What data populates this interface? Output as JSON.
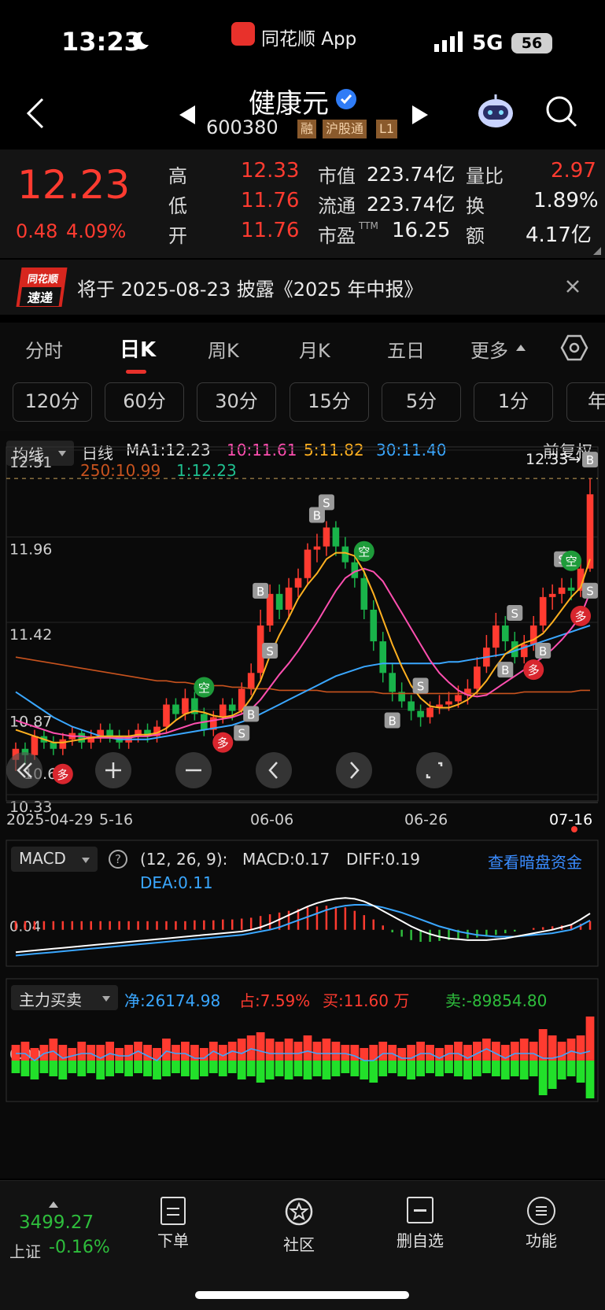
{
  "status_bar": {
    "time": "13:23",
    "app": "同花顺 App",
    "network": "5G",
    "battery": "56"
  },
  "header": {
    "name": "健康元",
    "code": "600380",
    "tags": [
      "融",
      "沪股通",
      "L1"
    ]
  },
  "quote": {
    "price": "12.23",
    "change": "0.48",
    "change_pct": "4.09%",
    "high_label": "高",
    "high": "12.33",
    "low_label": "低",
    "low": "11.76",
    "open_label": "开",
    "open": "11.76",
    "mktcap_label": "市值",
    "mktcap": "223.74亿",
    "float_label": "流通",
    "float": "223.74亿",
    "pe_label": "市盈",
    "pe_sup": "TTM",
    "pe": "16.25",
    "vr_label": "量比",
    "vr": "2.97",
    "turnover_label": "换",
    "turnover": "1.89%",
    "amount_label": "额",
    "amount": "4.17亿"
  },
  "notice": {
    "logo_top": "同花顺",
    "logo_bottom": "速递",
    "text": "将于 2025-08-23 披露《2025 年中报》"
  },
  "tabs": [
    "分时",
    "日K",
    "周K",
    "月K",
    "五日",
    "更多"
  ],
  "active_tab": "日K",
  "periods": [
    "120分",
    "60分",
    "30分",
    "15分",
    "5分",
    "1分",
    "年"
  ],
  "ma_legend": {
    "selector": "均线",
    "kind": "日线",
    "ma1": "MA1:12.23",
    "ma10": "10:11.61",
    "ma5": "5:11.82",
    "ma30": "30:11.40",
    "ma250": "250:10.99",
    "ma1b": "1:12.23",
    "adjust": "前复权"
  },
  "price_axis": [
    "12.51",
    "11.96",
    "11.42",
    "10.87",
    "10.33"
  ],
  "last_label": "10.60",
  "high_marker": "12.33→",
  "date_axis": [
    "2025-04-29",
    "5-16",
    "06-06",
    "06-26",
    "07-16"
  ],
  "macd": {
    "selector": "MACD",
    "params": "(12, 26, 9):",
    "macd": "MACD:0.17",
    "diff": "DIFF:0.19",
    "dea": "DEA:0.11",
    "link": "查看暗盘资金",
    "axis": "0.04"
  },
  "flow": {
    "selector": "主力买卖",
    "net": "净:26174.98",
    "pct": "占:7.59%",
    "buy": "买:11.60 万",
    "sell": "卖:-89854.80",
    "axis": "0.00"
  },
  "bottom": {
    "index_value": "3499.27",
    "index_name": "上证",
    "index_change": "-0.16%",
    "order": "下单",
    "community": "社区",
    "remove": "删自选",
    "functions": "功能"
  },
  "signals": {
    "buy": "B",
    "sell": "S",
    "bull": "多",
    "bear": "空"
  },
  "chart_data": {
    "type": "candlestick",
    "title": "",
    "x_range": [
      "2025-04-29",
      "07-16"
    ],
    "ylim": [
      10.33,
      12.51
    ],
    "candles": [
      [
        10.55,
        10.62,
        10.48,
        10.66
      ],
      [
        10.62,
        10.58,
        10.52,
        10.66
      ],
      [
        10.58,
        10.7,
        10.55,
        10.74
      ],
      [
        10.7,
        10.66,
        10.62,
        10.74
      ],
      [
        10.66,
        10.62,
        10.58,
        10.7
      ],
      [
        10.62,
        10.68,
        10.58,
        10.72
      ],
      [
        10.68,
        10.72,
        10.64,
        10.76
      ],
      [
        10.72,
        10.66,
        10.62,
        10.74
      ],
      [
        10.66,
        10.7,
        10.62,
        10.74
      ],
      [
        10.7,
        10.74,
        10.66,
        10.78
      ],
      [
        10.74,
        10.7,
        10.66,
        10.78
      ],
      [
        10.7,
        10.66,
        10.62,
        10.74
      ],
      [
        10.66,
        10.7,
        10.62,
        10.74
      ],
      [
        10.7,
        10.74,
        10.66,
        10.78
      ],
      [
        10.74,
        10.7,
        10.66,
        10.78
      ],
      [
        10.7,
        10.76,
        10.66,
        10.8
      ],
      [
        10.76,
        10.9,
        10.72,
        10.94
      ],
      [
        10.9,
        10.84,
        10.8,
        10.94
      ],
      [
        10.84,
        10.94,
        10.8,
        11.0
      ],
      [
        10.94,
        10.84,
        10.8,
        10.98
      ],
      [
        10.84,
        10.74,
        10.7,
        10.88
      ],
      [
        10.74,
        10.82,
        10.7,
        10.86
      ],
      [
        10.82,
        10.9,
        10.78,
        10.94
      ],
      [
        10.9,
        10.86,
        10.8,
        10.94
      ],
      [
        10.86,
        11.0,
        10.84,
        11.04
      ],
      [
        11.0,
        11.1,
        10.96,
        11.16
      ],
      [
        11.1,
        11.4,
        11.06,
        11.5
      ],
      [
        11.4,
        11.6,
        11.36,
        11.66
      ],
      [
        11.6,
        11.5,
        11.44,
        11.66
      ],
      [
        11.5,
        11.64,
        11.44,
        11.7
      ],
      [
        11.64,
        11.7,
        11.58,
        11.76
      ],
      [
        11.7,
        11.88,
        11.66,
        11.92
      ],
      [
        11.88,
        11.9,
        11.8,
        11.98
      ],
      [
        11.9,
        12.02,
        11.84,
        12.06
      ],
      [
        12.02,
        11.9,
        11.84,
        12.06
      ],
      [
        11.9,
        11.8,
        11.76,
        11.96
      ],
      [
        11.8,
        11.7,
        11.64,
        11.86
      ],
      [
        11.7,
        11.5,
        11.44,
        11.76
      ],
      [
        11.5,
        11.3,
        11.24,
        11.56
      ],
      [
        11.3,
        11.1,
        11.04,
        11.36
      ],
      [
        11.1,
        10.98,
        10.92,
        11.16
      ],
      [
        10.98,
        10.92,
        10.88,
        11.04
      ],
      [
        10.92,
        10.86,
        10.8,
        10.96
      ],
      [
        10.86,
        10.82,
        10.76,
        10.9
      ],
      [
        10.82,
        10.88,
        10.78,
        10.92
      ],
      [
        10.88,
        10.9,
        10.84,
        10.96
      ],
      [
        10.9,
        10.92,
        10.86,
        10.98
      ],
      [
        10.92,
        10.96,
        10.88,
        11.02
      ],
      [
        10.96,
        11.0,
        10.9,
        11.06
      ],
      [
        11.0,
        11.14,
        10.96,
        11.2
      ],
      [
        11.14,
        11.26,
        11.1,
        11.34
      ],
      [
        11.26,
        11.4,
        11.2,
        11.48
      ],
      [
        11.4,
        11.3,
        11.24,
        11.46
      ],
      [
        11.3,
        11.2,
        11.16,
        11.36
      ],
      [
        11.2,
        11.28,
        11.16,
        11.34
      ],
      [
        11.28,
        11.4,
        11.24,
        11.46
      ],
      [
        11.4,
        11.58,
        11.36,
        11.64
      ],
      [
        11.58,
        11.6,
        11.5,
        11.66
      ],
      [
        11.6,
        11.64,
        11.54,
        11.7
      ],
      [
        11.64,
        11.62,
        11.56,
        11.7
      ],
      [
        11.62,
        11.76,
        11.58,
        11.82
      ],
      [
        11.76,
        12.23,
        11.74,
        12.33
      ]
    ],
    "series": [
      {
        "name": "5",
        "values": [
          10.74,
          10.72,
          10.7,
          10.68,
          10.66,
          10.66,
          10.67,
          10.68,
          10.69,
          10.7,
          10.7,
          10.7,
          10.7,
          10.71,
          10.71,
          10.72,
          10.75,
          10.8,
          10.84,
          10.86,
          10.85,
          10.83,
          10.82,
          10.83,
          10.86,
          10.94,
          11.05,
          11.21,
          11.34,
          11.45,
          11.57,
          11.66,
          11.73,
          11.82,
          11.86,
          11.86,
          11.84,
          11.74,
          11.6,
          11.44,
          11.28,
          11.14,
          11.02,
          10.94,
          10.89,
          10.88,
          10.88,
          10.9,
          10.93,
          10.98,
          11.05,
          11.14,
          11.22,
          11.26,
          11.29,
          11.31,
          11.35,
          11.42,
          11.5,
          11.58,
          11.64,
          11.82
        ]
      },
      {
        "name": "10",
        "values": [
          10.8,
          10.78,
          10.76,
          10.74,
          10.72,
          10.71,
          10.7,
          10.7,
          10.69,
          10.69,
          10.69,
          10.69,
          10.69,
          10.7,
          10.7,
          10.71,
          10.72,
          10.74,
          10.76,
          10.78,
          10.79,
          10.8,
          10.81,
          10.82,
          10.84,
          10.87,
          10.93,
          11.01,
          11.09,
          11.16,
          11.24,
          11.33,
          11.42,
          11.52,
          11.62,
          11.7,
          11.74,
          11.76,
          11.74,
          11.68,
          11.58,
          11.48,
          11.38,
          11.28,
          11.18,
          11.1,
          11.04,
          10.99,
          10.96,
          10.95,
          10.96,
          11.0,
          11.04,
          11.08,
          11.12,
          11.16,
          11.2,
          11.25,
          11.31,
          11.38,
          11.46,
          11.61
        ]
      }
    ],
    "ma30": [
      10.98,
      10.94,
      10.9,
      10.86,
      10.82,
      10.79,
      10.76,
      10.74,
      10.72,
      10.7,
      10.69,
      10.68,
      10.68,
      10.68,
      10.68,
      10.69,
      10.7,
      10.71,
      10.72,
      10.73,
      10.74,
      10.75,
      10.76,
      10.77,
      10.79,
      10.81,
      10.84,
      10.87,
      10.9,
      10.93,
      10.96,
      10.99,
      11.02,
      11.05,
      11.08,
      11.1,
      11.12,
      11.14,
      11.15,
      11.16,
      11.16,
      11.16,
      11.16,
      11.16,
      11.16,
      11.16,
      11.17,
      11.17,
      11.18,
      11.19,
      11.2,
      11.21,
      11.22,
      11.24,
      11.26,
      11.28,
      11.3,
      11.32,
      11.34,
      11.36,
      11.38,
      11.4
    ],
    "ma250": [
      11.2,
      11.19,
      11.18,
      11.17,
      11.16,
      11.15,
      11.14,
      11.13,
      11.12,
      11.11,
      11.1,
      11.09,
      11.08,
      11.07,
      11.06,
      11.05,
      11.05,
      11.04,
      11.04,
      11.03,
      11.03,
      11.02,
      11.02,
      11.01,
      11.01,
      11.0,
      11.0,
      11.0,
      10.99,
      10.99,
      10.99,
      10.99,
      10.99,
      10.98,
      10.98,
      10.98,
      10.98,
      10.98,
      10.98,
      10.97,
      10.97,
      10.97,
      10.97,
      10.97,
      10.97,
      10.97,
      10.97,
      10.97,
      10.97,
      10.97,
      10.97,
      10.97,
      10.97,
      10.97,
      10.98,
      10.98,
      10.98,
      10.98,
      10.98,
      10.98,
      10.99,
      10.99
    ],
    "macd_hist": [
      0.1,
      0.1,
      0.1,
      0.1,
      0.1,
      0.1,
      0.1,
      0.1,
      0.1,
      0.1,
      0.1,
      0.1,
      0.1,
      0.1,
      0.1,
      0.1,
      0.1,
      0.1,
      0.1,
      0.11,
      0.11,
      0.11,
      0.12,
      0.12,
      0.13,
      0.14,
      0.16,
      0.18,
      0.2,
      0.22,
      0.24,
      0.26,
      0.27,
      0.28,
      0.27,
      0.26,
      0.22,
      0.17,
      0.12,
      0.05,
      -0.03,
      -0.08,
      -0.12,
      -0.14,
      -0.14,
      -0.13,
      -0.12,
      -0.11,
      -0.1,
      -0.09,
      -0.08,
      -0.06,
      -0.04,
      -0.02,
      0.0,
      0.02,
      0.03,
      0.04,
      0.05,
      0.06,
      0.07,
      0.1
    ],
    "macd_diff": [
      -0.26,
      -0.25,
      -0.24,
      -0.23,
      -0.22,
      -0.21,
      -0.2,
      -0.19,
      -0.18,
      -0.17,
      -0.16,
      -0.15,
      -0.14,
      -0.13,
      -0.12,
      -0.11,
      -0.1,
      -0.09,
      -0.08,
      -0.07,
      -0.06,
      -0.05,
      -0.04,
      -0.03,
      -0.02,
      0.0,
      0.03,
      0.07,
      0.12,
      0.17,
      0.22,
      0.27,
      0.31,
      0.34,
      0.36,
      0.37,
      0.36,
      0.33,
      0.28,
      0.22,
      0.16,
      0.1,
      0.04,
      -0.01,
      -0.05,
      -0.08,
      -0.1,
      -0.11,
      -0.12,
      -0.12,
      -0.12,
      -0.11,
      -0.1,
      -0.08,
      -0.06,
      -0.04,
      -0.02,
      0.0,
      0.03,
      0.06,
      0.12,
      0.19
    ],
    "macd_dea": [
      -0.3,
      -0.29,
      -0.28,
      -0.27,
      -0.26,
      -0.25,
      -0.24,
      -0.23,
      -0.22,
      -0.21,
      -0.2,
      -0.19,
      -0.18,
      -0.17,
      -0.16,
      -0.15,
      -0.14,
      -0.13,
      -0.12,
      -0.11,
      -0.1,
      -0.09,
      -0.08,
      -0.07,
      -0.06,
      -0.04,
      -0.02,
      0.0,
      0.03,
      0.07,
      0.11,
      0.15,
      0.19,
      0.23,
      0.26,
      0.28,
      0.29,
      0.29,
      0.28,
      0.26,
      0.23,
      0.2,
      0.16,
      0.12,
      0.08,
      0.04,
      0.01,
      -0.02,
      -0.04,
      -0.06,
      -0.07,
      -0.08,
      -0.08,
      -0.08,
      -0.07,
      -0.06,
      -0.05,
      -0.04,
      -0.02,
      0.0,
      0.05,
      0.11
    ],
    "flow_buy": [
      0.5,
      0.6,
      0.4,
      0.5,
      0.7,
      0.5,
      0.4,
      0.6,
      0.5,
      0.5,
      0.6,
      0.4,
      0.5,
      0.6,
      0.5,
      0.4,
      0.7,
      0.5,
      0.6,
      0.5,
      0.4,
      0.6,
      0.5,
      0.6,
      0.7,
      0.8,
      0.9,
      0.7,
      0.6,
      0.7,
      0.6,
      0.8,
      0.6,
      0.7,
      0.6,
      0.5,
      0.5,
      0.4,
      0.5,
      0.6,
      0.5,
      0.4,
      0.5,
      0.6,
      0.5,
      0.4,
      0.5,
      0.6,
      0.5,
      0.6,
      0.7,
      0.6,
      0.5,
      0.6,
      0.7,
      0.6,
      1.0,
      0.8,
      0.6,
      0.7,
      0.8,
      1.4
    ],
    "flow_sell": [
      -0.4,
      -0.5,
      -0.6,
      -0.4,
      -0.5,
      -0.6,
      -0.4,
      -0.5,
      -0.4,
      -0.6,
      -0.5,
      -0.4,
      -0.5,
      -0.4,
      -0.5,
      -0.6,
      -0.5,
      -0.4,
      -0.5,
      -0.6,
      -0.5,
      -0.4,
      -0.5,
      -0.4,
      -0.6,
      -0.5,
      -0.7,
      -0.6,
      -0.5,
      -0.6,
      -0.5,
      -0.6,
      -0.5,
      -0.6,
      -0.5,
      -0.4,
      -0.5,
      -0.6,
      -0.7,
      -0.5,
      -0.4,
      -0.5,
      -0.6,
      -0.5,
      -0.4,
      -0.5,
      -0.4,
      -0.5,
      -0.6,
      -0.5,
      -0.4,
      -0.5,
      -0.6,
      -0.5,
      -0.6,
      -0.5,
      -1.1,
      -0.9,
      -0.6,
      -0.5,
      -0.7,
      -1.2
    ]
  }
}
